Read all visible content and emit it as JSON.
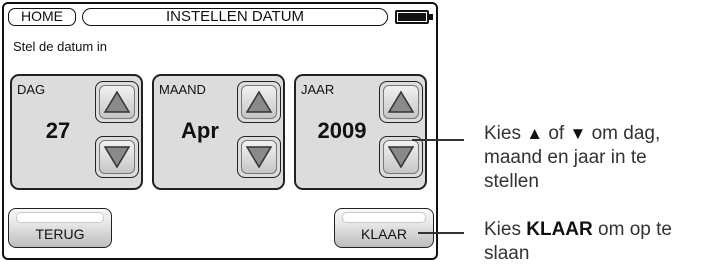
{
  "header": {
    "home_label": "HOME",
    "title": "INSTELLEN DATUM"
  },
  "subtitle": "Stel de datum in",
  "panels": [
    {
      "label": "DAG",
      "value": "27"
    },
    {
      "label": "MAAND",
      "value": "Apr"
    },
    {
      "label": "JAAR",
      "value": "2009"
    }
  ],
  "buttons": {
    "back_label": "TERUG",
    "done_label": "KLAAR"
  },
  "annotations": {
    "arrows": {
      "prefix": "Kies",
      "up_glyph": "▲",
      "middle": "of",
      "down_glyph": "▼",
      "suffix": "om dag,",
      "line2": "maand en jaar in te",
      "line3": "stellen"
    },
    "done": {
      "prefix": "Kies",
      "bold": "KLAAR",
      "suffix": "om op te",
      "line2": "slaan"
    }
  },
  "icons": {
    "battery": "battery-full-icon",
    "up": "up-triangle-icon",
    "down": "down-triangle-icon"
  },
  "colors": {
    "panel_bg": "#dcdcdc",
    "outline": "#111111",
    "annotation_text": "#333333"
  }
}
